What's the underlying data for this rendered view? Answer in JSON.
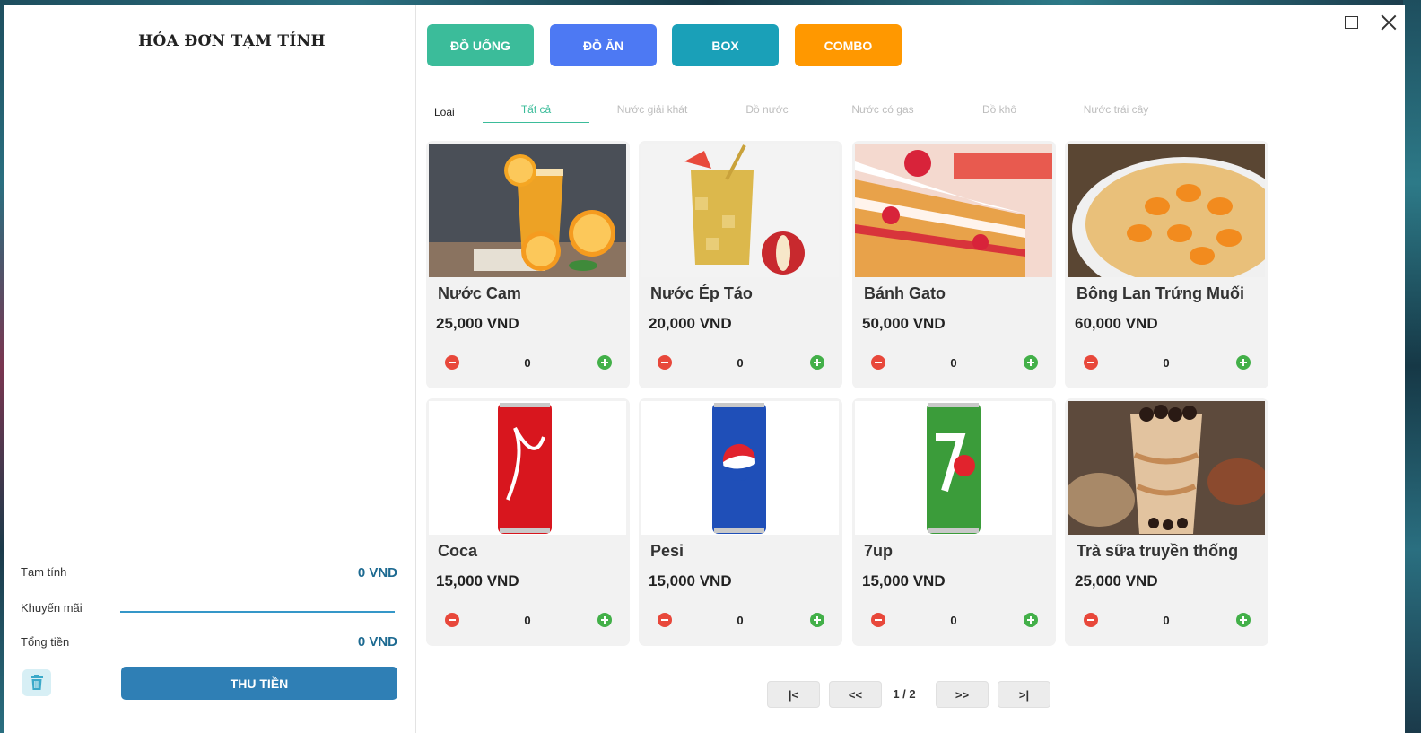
{
  "bill": {
    "title": "HÓA ĐƠN TẠM TÍNH",
    "subtotal_label": "Tạm tính",
    "subtotal_value": "0 VND",
    "promotion_label": "Khuyến mãi",
    "promotion_value": "",
    "total_label": "Tổng tiền",
    "total_value": "0 VND",
    "collect_label": "THU TIỀN",
    "trash_icon": "trash-icon"
  },
  "categories": [
    {
      "label": "ĐỒ UỐNG",
      "color": "#3bbc9a"
    },
    {
      "label": "ĐỒ ĂN",
      "color": "#4d79f3"
    },
    {
      "label": "BOX",
      "color": "#1aa0b8"
    },
    {
      "label": "COMBO",
      "color": "#ff9800"
    }
  ],
  "type_filter": {
    "label": "Loại",
    "tabs": [
      "Tất cả",
      "Nước giải khát",
      "Đồ nước",
      "Nước có gas",
      "Đồ khô",
      "Nước trái cây"
    ],
    "active": "Tất cả"
  },
  "products": [
    {
      "name": "Nước Cam",
      "price": "25,000 VND",
      "qty": "0"
    },
    {
      "name": "Nước Ép Táo",
      "price": "20,000 VND",
      "qty": "0"
    },
    {
      "name": "Bánh Gato",
      "price": "50,000 VND",
      "qty": "0"
    },
    {
      "name": "Bông Lan Trứng Muối",
      "price": "60,000 VND",
      "qty": "0"
    },
    {
      "name": "Coca",
      "price": "15,000 VND",
      "qty": "0"
    },
    {
      "name": "Pesi",
      "price": "15,000 VND",
      "qty": "0"
    },
    {
      "name": "7up",
      "price": "15,000 VND",
      "qty": "0"
    },
    {
      "name": "Trà sữa truyền thống",
      "price": "25,000 VND",
      "qty": "0"
    }
  ],
  "pagination": {
    "first": "|<",
    "prev": "<<",
    "page": "1 / 2",
    "next": ">>",
    "last": ">|"
  },
  "colors": {
    "accent": "#3bbc9a",
    "total_text": "#1d6a91",
    "collect_button": "#2f7fb5",
    "minus": "#e8483b",
    "plus": "#43b049"
  }
}
